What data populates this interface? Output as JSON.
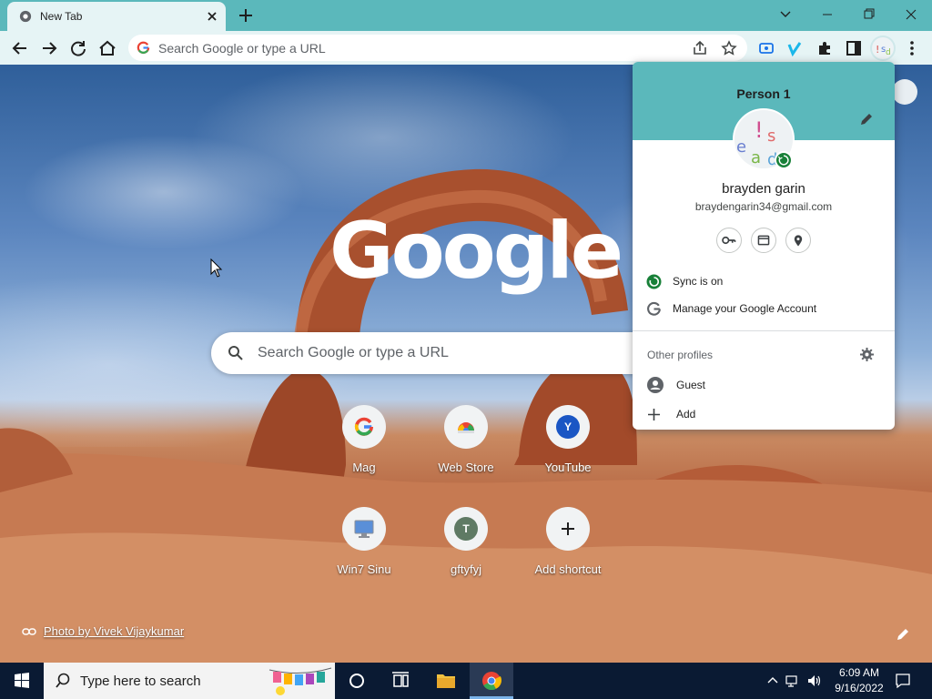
{
  "browser": {
    "tab": {
      "title": "New Tab"
    },
    "omnibox": {
      "placeholder": "Search Google or type a URL"
    }
  },
  "ntp": {
    "logo_text": "Google",
    "search_placeholder": "Search Google or type a URL",
    "shortcuts": [
      {
        "label": "Mag",
        "icon": "google-g-icon"
      },
      {
        "label": "Web Store",
        "icon": "chrome-web-store-icon"
      },
      {
        "label": "YouTube",
        "icon": "letter-y-icon",
        "letter": "Y"
      },
      {
        "label": "Win7 Sinu",
        "icon": "monitor-icon"
      },
      {
        "label": "gftyfyj",
        "icon": "letter-t-icon",
        "letter": "T"
      },
      {
        "label": "Add shortcut",
        "icon": "plus-icon"
      }
    ],
    "photo_credit": "Photo by Vivek Vijaykumar"
  },
  "profile_menu": {
    "profile_name": "Person 1",
    "user_name": "brayden garin",
    "user_email": "braydengarin34@gmail.com",
    "sync_label": "Sync is on",
    "manage_account_label": "Manage your Google Account",
    "other_profiles_label": "Other profiles",
    "guest_label": "Guest",
    "add_label": "Add"
  },
  "taskbar": {
    "search_placeholder": "Type here to search",
    "time": "6:09 AM",
    "date": "9/16/2022"
  },
  "colors": {
    "frame": "#5bb8bb",
    "toolbar": "#e6f4f5",
    "taskbar": "#0a1a33",
    "sync_green": "#188038",
    "youtube_circle": "#1a56c4",
    "t_circle": "#5f7a64"
  }
}
